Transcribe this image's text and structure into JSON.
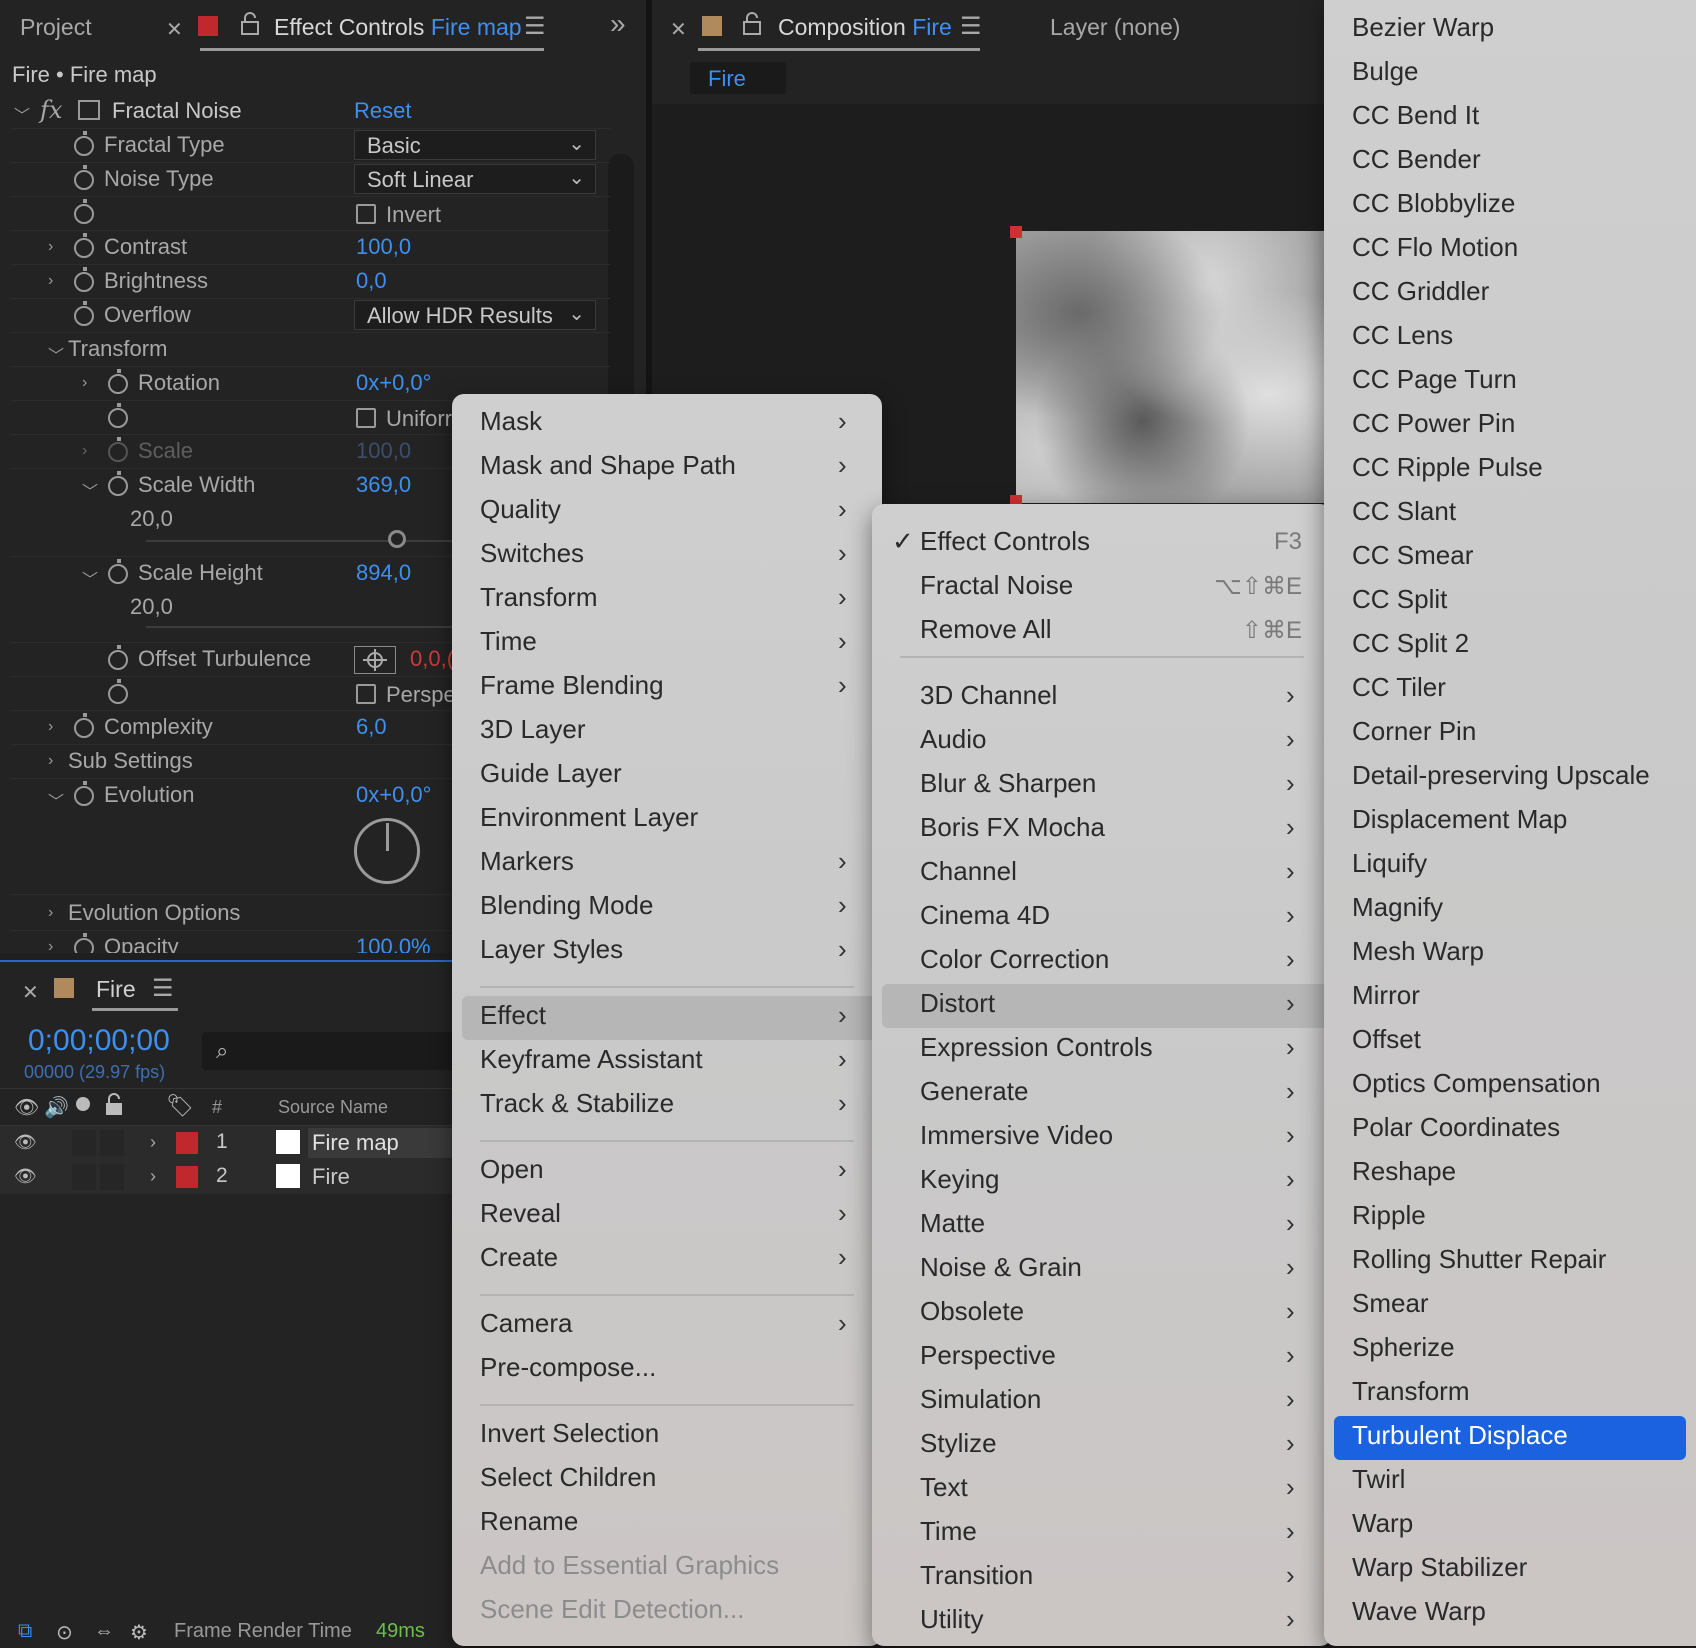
{
  "tabs_left": {
    "project": "Project",
    "effect_controls": "Effect Controls",
    "effect_controls_layer": "Fire map",
    "more": "»"
  },
  "tabs_right": {
    "composition": "Composition",
    "composition_name": "Fire",
    "layer": "Layer (none)",
    "comp_tab": "Fire"
  },
  "effect_controls": {
    "breadcrumb": "Fire • Fire map",
    "effect_name": "Fractal Noise",
    "reset": "Reset",
    "fractal_type_label": "Fractal Type",
    "fractal_type_value": "Basic",
    "noise_type_label": "Noise Type",
    "noise_type_value": "Soft Linear",
    "invert_label": "Invert",
    "contrast_label": "Contrast",
    "contrast_value": "100,0",
    "brightness_label": "Brightness",
    "brightness_value": "0,0",
    "overflow_label": "Overflow",
    "overflow_value": "Allow HDR Results",
    "transform_label": "Transform",
    "rotation_label": "Rotation",
    "rotation_value": "0x+0,0°",
    "uniform_label": "Uniforr",
    "scale_label": "Scale",
    "scale_value": "100,0",
    "scale_width_label": "Scale Width",
    "scale_width_value": "369,0",
    "scale_width_slider_min": "20,0",
    "scale_height_label": "Scale Height",
    "scale_height_value": "894,0",
    "scale_height_slider_min": "20,0",
    "offset_turbulence_label": "Offset Turbulence",
    "offset_turbulence_value": "0,0,(",
    "perspective_label": "Perspe",
    "complexity_label": "Complexity",
    "complexity_value": "6,0",
    "sub_settings_label": "Sub Settings",
    "evolution_label": "Evolution",
    "evolution_value": "0x+0,0°",
    "evolution_options_label": "Evolution Options",
    "opacity_label": "Opacity",
    "opacity_value": "100,0%"
  },
  "timeline": {
    "comp_name": "Fire",
    "timecode": "0;00;00;00",
    "frame_info": "00000 (29.97 fps)",
    "col_num": "#",
    "col_source": "Source Name",
    "layers": [
      {
        "num": "1",
        "name": "Fire map"
      },
      {
        "num": "2",
        "name": "Fire"
      }
    ],
    "footer_label": "Frame Render Time",
    "footer_value": "49ms"
  },
  "context_menu": {
    "items": [
      "Mask",
      "Mask and Shape Path",
      "Quality",
      "Switches",
      "Transform",
      "Time",
      "Frame Blending",
      "3D Layer",
      "Guide Layer",
      "Environment Layer",
      "Markers",
      "Blending Mode",
      "Layer Styles",
      "Effect",
      "Keyframe Assistant",
      "Track & Stabilize",
      "Open",
      "Reveal",
      "Create",
      "Camera",
      "Pre-compose...",
      "Invert Selection",
      "Select Children",
      "Rename",
      "Add to Essential Graphics",
      "Scene Edit Detection..."
    ]
  },
  "effect_menu": {
    "check": "✓",
    "top_items": [
      {
        "label": "Effect Controls",
        "shortcut": "F3"
      },
      {
        "label": "Fractal Noise",
        "shortcut": "⌥⇧⌘E"
      },
      {
        "label": "Remove All",
        "shortcut": "⇧⌘E"
      }
    ],
    "categories": [
      "3D Channel",
      "Audio",
      "Blur & Sharpen",
      "Boris FX Mocha",
      "Channel",
      "Cinema 4D",
      "Color Correction",
      "Distort",
      "Expression Controls",
      "Generate",
      "Immersive Video",
      "Keying",
      "Matte",
      "Noise & Grain",
      "Obsolete",
      "Perspective",
      "Simulation",
      "Stylize",
      "Text",
      "Time",
      "Transition",
      "Utility"
    ]
  },
  "distort_menu": {
    "items": [
      "Bezier Warp",
      "Bulge",
      "CC Bend It",
      "CC Bender",
      "CC Blobbylize",
      "CC Flo Motion",
      "CC Griddler",
      "CC Lens",
      "CC Page Turn",
      "CC Power Pin",
      "CC Ripple Pulse",
      "CC Slant",
      "CC Smear",
      "CC Split",
      "CC Split 2",
      "CC Tiler",
      "Corner Pin",
      "Detail-preserving Upscale",
      "Displacement Map",
      "Liquify",
      "Magnify",
      "Mesh Warp",
      "Mirror",
      "Offset",
      "Optics Compensation",
      "Polar Coordinates",
      "Reshape",
      "Ripple",
      "Rolling Shutter Repair",
      "Smear",
      "Spherize",
      "Transform",
      "Turbulent Displace",
      "Twirl",
      "Warp",
      "Warp Stabilizer",
      "Wave Warp"
    ]
  },
  "colors": {
    "accent_blue": "#3d8ff0",
    "highlight_blue": "#1b62e0",
    "label_red": "#c0282d",
    "comp_tan": "#b08a5c"
  }
}
